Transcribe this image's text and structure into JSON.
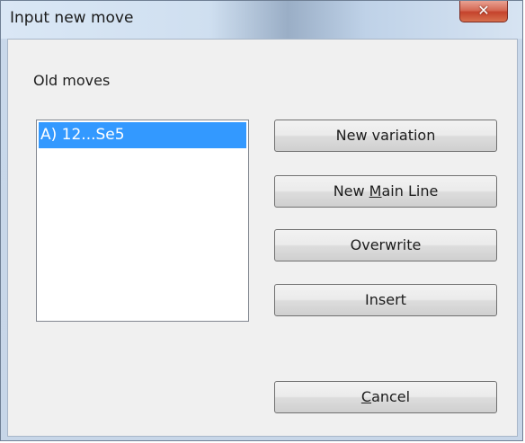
{
  "window": {
    "title": "Input new move"
  },
  "old_moves": {
    "label": "Old moves",
    "items": [
      "A) 12...Se5"
    ],
    "selected_index": 0
  },
  "buttons": {
    "new_variation": "New variation",
    "new_main_line": {
      "before": "New ",
      "mnemonic": "M",
      "after": "ain Line"
    },
    "overwrite": "Overwrite",
    "insert": "Insert",
    "cancel": {
      "mnemonic": "C",
      "after": "ancel"
    }
  },
  "colors": {
    "selection": "#3399ff",
    "close_button": "#c5432c"
  }
}
